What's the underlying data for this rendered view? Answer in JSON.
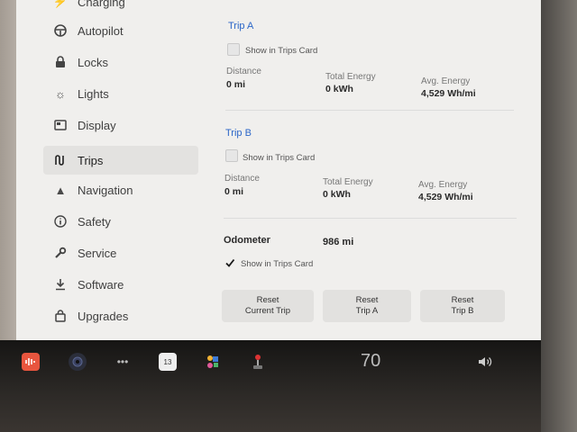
{
  "sidebar": {
    "items": [
      {
        "label": "Charging",
        "icon": "charging-icon"
      },
      {
        "label": "Autopilot",
        "icon": "steering-wheel-icon"
      },
      {
        "label": "Locks",
        "icon": "lock-icon"
      },
      {
        "label": "Lights",
        "icon": "sun-icon"
      },
      {
        "label": "Display",
        "icon": "display-icon"
      },
      {
        "label": "Trips",
        "icon": "trips-icon",
        "active": true
      },
      {
        "label": "Navigation",
        "icon": "navigation-arrow-icon"
      },
      {
        "label": "Safety",
        "icon": "info-circle-icon"
      },
      {
        "label": "Service",
        "icon": "wrench-icon"
      },
      {
        "label": "Software",
        "icon": "download-icon"
      },
      {
        "label": "Upgrades",
        "icon": "bag-icon"
      }
    ]
  },
  "trip_a": {
    "title": "Trip A",
    "show_label": "Show in Trips Card",
    "show_checked": false,
    "distance_label": "Distance",
    "distance_value": "0 mi",
    "energy_label": "Total Energy",
    "energy_value": "0 kWh",
    "avg_label": "Avg. Energy",
    "avg_value": "4,529 Wh/mi"
  },
  "trip_b": {
    "title": "Trip B",
    "show_label": "Show in Trips Card",
    "show_checked": false,
    "distance_label": "Distance",
    "distance_value": "0 mi",
    "energy_label": "Total Energy",
    "energy_value": "0 kWh",
    "avg_label": "Avg. Energy",
    "avg_value": "4,529 Wh/mi"
  },
  "odometer": {
    "label": "Odometer",
    "value": "986 mi",
    "show_label": "Show in Trips Card",
    "show_checked": true
  },
  "buttons": {
    "reset_current_l1": "Reset",
    "reset_current_l2": "Current Trip",
    "reset_a_l1": "Reset",
    "reset_a_l2": "Trip A",
    "reset_b_l1": "Reset",
    "reset_b_l2": "Trip B"
  },
  "taskbar": {
    "calendar_day": "13",
    "speed": "70",
    "colors": {
      "audio": "#e8553e",
      "calendar": "#e23d3d"
    }
  }
}
